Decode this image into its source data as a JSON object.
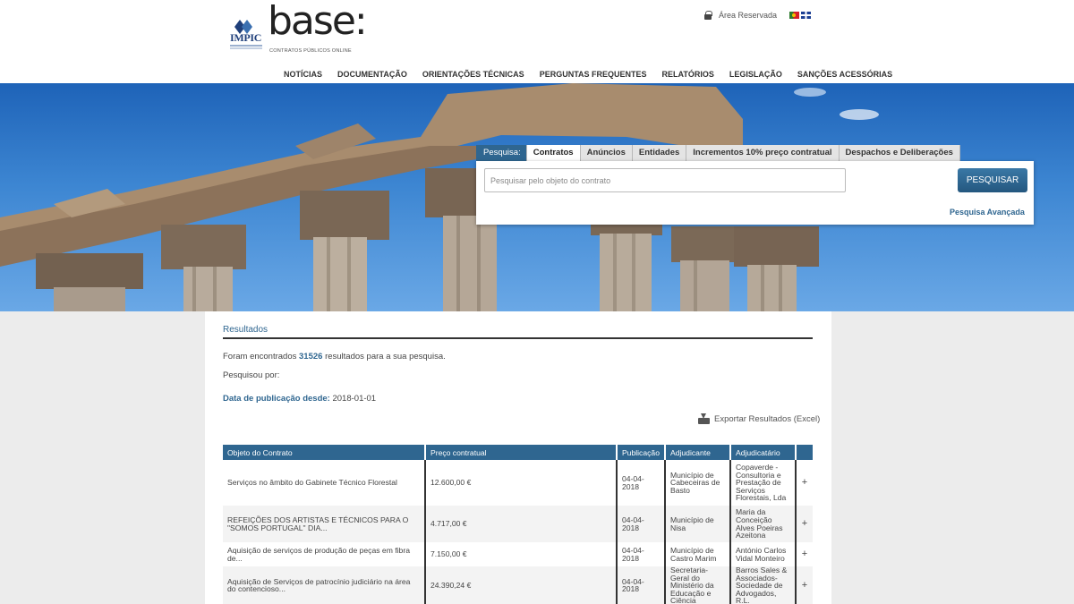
{
  "brand": {
    "impic": "IMPIC",
    "logo_word": "base:",
    "tagline": "CONTRATOS PÚBLICOS ONLINE"
  },
  "top": {
    "reserved_area": "Área Reservada",
    "lang_pt": "PT flag",
    "lang_en": "EN flag"
  },
  "nav": [
    "NOTÍCIAS",
    "DOCUMENTAÇÃO",
    "ORIENTAÇÕES TÉCNICAS",
    "PERGUNTAS FREQUENTES",
    "RELATÓRIOS",
    "LEGISLAÇÃO",
    "SANÇÕES ACESSÓRIAS"
  ],
  "search": {
    "label": "Pesquisa:",
    "tabs": [
      "Contratos",
      "Anúncios",
      "Entidades",
      "Incrementos 10% preço contratual",
      "Despachos e Deliberações"
    ],
    "active_tab": "Contratos",
    "placeholder": "Pesquisar pelo objeto do contrato",
    "value": "",
    "button": "PESQUISAR",
    "advanced": "Pesquisa Avançada"
  },
  "results": {
    "title": "Resultados",
    "found_pre": "Foram encontrados",
    "found_count": "31526",
    "found_post": "resultados para a sua pesquisa.",
    "searched_by": "Pesquisou por:",
    "date_key": "Data de publicação desde:",
    "date_value": "2018-01-01",
    "export": "Exportar Resultados (Excel)",
    "columns": [
      "Objeto do Contrato",
      "Preço contratual",
      "Publicação",
      "Adjudicante",
      "Adjudicatário",
      ""
    ],
    "rows": [
      {
        "objeto": "Serviços no âmbito do Gabinete Técnico Florestal",
        "preco": "12.600,00 €",
        "publicacao": "04-04-2018",
        "adjudicante": "Município de Cabeceiras de Basto",
        "adjudicatario": "Copaverde - Consultoria e Prestação de Serviços Florestais, Lda",
        "action": "+"
      },
      {
        "objeto": "REFEIÇÕES DOS ARTISTAS E TÉCNICOS PARA O \"SOMOS PORTUGAL\" DIA...",
        "preco": "4.717,00 €",
        "publicacao": "04-04-2018",
        "adjudicante": "Município de Nisa",
        "adjudicatario": "Maria da Conceição Alves Poeiras Azeitona",
        "action": "+"
      },
      {
        "objeto": "Aquisição de serviços de produção de peças em fibra de...",
        "preco": "7.150,00 €",
        "publicacao": "04-04-2018",
        "adjudicante": "Município de Castro Marim",
        "adjudicatario": "António Carlos Vidal Monteiro",
        "action": "+"
      },
      {
        "objeto": "Aquisição de Serviços de patrocínio judiciário na área do contencioso...",
        "preco": "24.390,24 €",
        "publicacao": "04-04-2018",
        "adjudicante": "Secretaria-Geral do Ministério da Educação e Ciência",
        "adjudicatario": "Barros Sales & Associados- Sociedade de Advogados, R.L.",
        "action": "+"
      }
    ]
  }
}
